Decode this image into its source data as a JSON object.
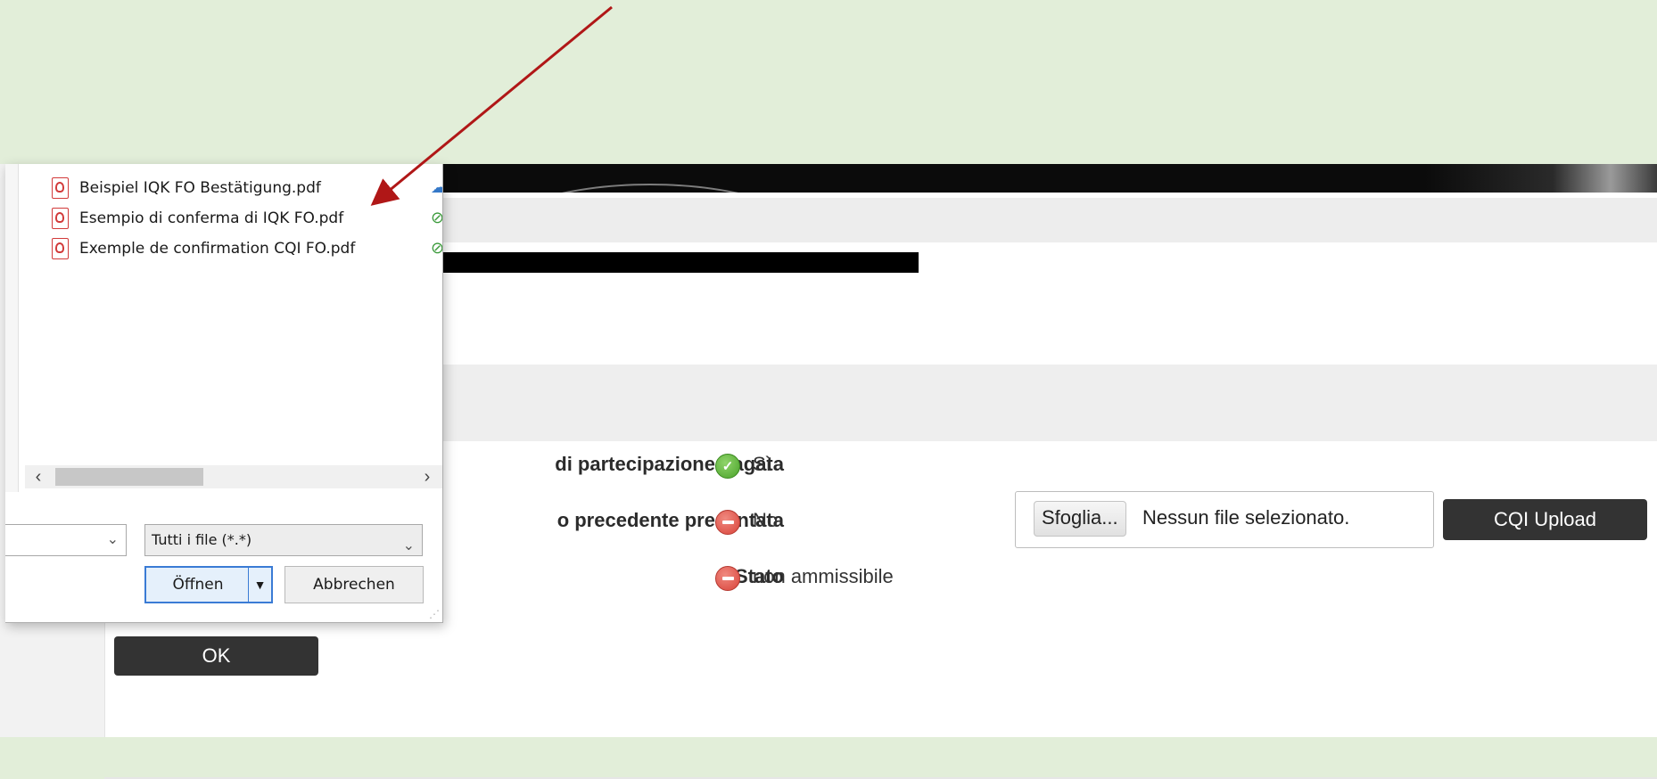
{
  "dialog": {
    "files": [
      {
        "name": "Beispiel IQK FO Bestätigung.pdf",
        "sync_icon": "cloud-icon"
      },
      {
        "name": "Esempio di conferma di IQK FO.pdf",
        "sync_icon": "check-circle-icon"
      },
      {
        "name": "Exemple de confirmation CQI FO.pdf",
        "sync_icon": "check-circle-icon"
      }
    ],
    "filetype_selected": "Tutti i file (*.*)",
    "open_label": "Öffnen",
    "cancel_label": "Abbrechen"
  },
  "form": {
    "rows": [
      {
        "label": "di partecipazione pagata",
        "status": "ok",
        "value": "Sì"
      },
      {
        "label": "o precedente presentata",
        "status": "no",
        "value": "No"
      },
      {
        "label": "Stato",
        "status": "no",
        "value": "non ammissibile"
      }
    ],
    "browse_label": "Sfoglia...",
    "no_file_label": "Nessun file selezionato.",
    "upload_label": "CQI Upload",
    "ok_label": "OK"
  },
  "colors": {
    "background": "#e2eed9",
    "status_ok": "#4aa22a",
    "status_no": "#d9433a",
    "button_dark": "#333333",
    "annotation_arrow": "#b01717"
  }
}
